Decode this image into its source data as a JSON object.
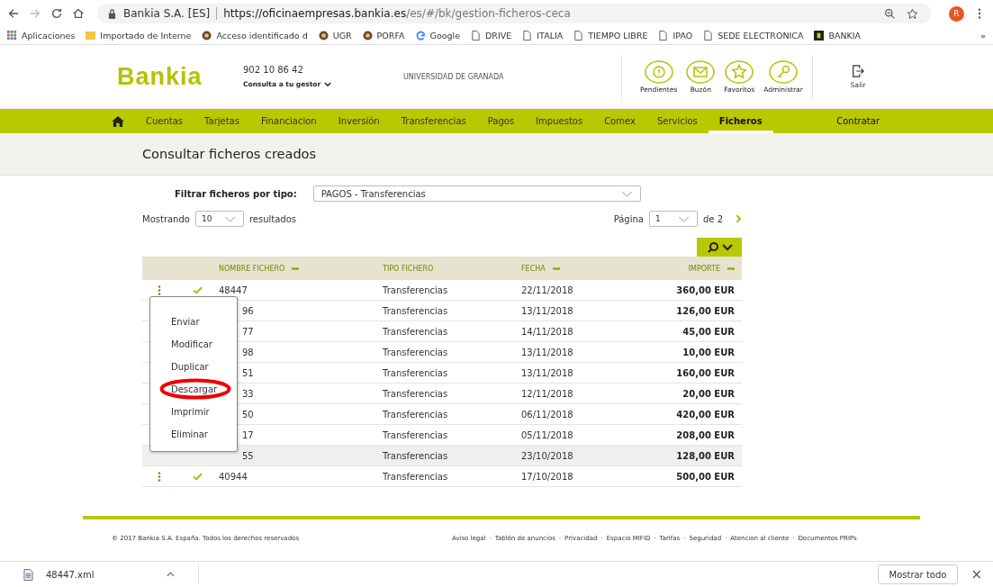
{
  "browser": {
    "site_name": "Bankia S.A. [ES]",
    "url_host": "https://oficinaempresas.bankia.es",
    "url_path": "/es/#/bk/gestion-ficheros-ceca",
    "profile_initial": "R",
    "bookmarks": [
      {
        "label": "Aplicaciones",
        "kind": "apps"
      },
      {
        "label": "Importado de Interne",
        "kind": "folder"
      },
      {
        "label": "Acceso identificado d",
        "kind": "crest"
      },
      {
        "label": "UGR",
        "kind": "crest"
      },
      {
        "label": "PORFA",
        "kind": "crest"
      },
      {
        "label": "Google",
        "kind": "google"
      },
      {
        "label": "DRIVE",
        "kind": "page"
      },
      {
        "label": "ITALIA",
        "kind": "page"
      },
      {
        "label": "TIEMPO LIBRE",
        "kind": "page"
      },
      {
        "label": "IPAO",
        "kind": "page"
      },
      {
        "label": "SEDE ELECTRONICA",
        "kind": "page"
      },
      {
        "label": "BANKIA",
        "kind": "brand"
      }
    ],
    "more": "»"
  },
  "header": {
    "logo": "Bankia",
    "phone": "902 10 86 42",
    "contact": "Consulta a tu gestor",
    "company": "UNIVERSIDAD DE GRANADA",
    "actions": [
      {
        "label": "Pendientes",
        "kind": "alert"
      },
      {
        "label": "Buzón",
        "kind": "mail"
      },
      {
        "label": "Favoritos",
        "kind": "star"
      },
      {
        "label": "Administrar",
        "kind": "key"
      }
    ],
    "logout": "Salir"
  },
  "nav": {
    "items": [
      {
        "label": "Cuentas",
        "selected": false
      },
      {
        "label": "Tarjetas",
        "selected": false
      },
      {
        "label": "Financiacion",
        "selected": false
      },
      {
        "label": "Inversión",
        "selected": false
      },
      {
        "label": "Transferencias",
        "selected": false
      },
      {
        "label": "Pagos",
        "selected": false
      },
      {
        "label": "Impuestos",
        "selected": false
      },
      {
        "label": "Comex",
        "selected": false
      },
      {
        "label": "Servicios",
        "selected": false
      },
      {
        "label": "Ficheros",
        "selected": true
      }
    ],
    "contract": "Contratar"
  },
  "page_title": "Consultar ficheros creados",
  "filter": {
    "label": "Filtrar ficheros por tipo:",
    "value": "PAGOS - Transferencias"
  },
  "paging": {
    "showing": "Mostrando",
    "per_page": "10",
    "results": "resultados",
    "page_label": "Página",
    "page": "1",
    "of": "de 2"
  },
  "table": {
    "columns": [
      "NOMBRE FICHERO",
      "TIPO FICHERO",
      "FECHA",
      "IMPORTE"
    ],
    "rows": [
      {
        "name": "48447",
        "type": "Transferencias",
        "date": "22/11/2018",
        "amount": "360,00 EUR",
        "covered": false,
        "highlighted": false
      },
      {
        "name": "96",
        "type": "Transferencias",
        "date": "13/11/2018",
        "amount": "126,00 EUR",
        "covered": true,
        "highlighted": false
      },
      {
        "name": "77",
        "type": "Transferencias",
        "date": "14/11/2018",
        "amount": "45,00 EUR",
        "covered": true,
        "highlighted": false
      },
      {
        "name": "98",
        "type": "Transferencias",
        "date": "13/11/2018",
        "amount": "10,00 EUR",
        "covered": true,
        "highlighted": false
      },
      {
        "name": "51",
        "type": "Transferencias",
        "date": "13/11/2018",
        "amount": "160,00 EUR",
        "covered": true,
        "highlighted": false
      },
      {
        "name": "33",
        "type": "Transferencias",
        "date": "12/11/2018",
        "amount": "20,00 EUR",
        "covered": true,
        "highlighted": false
      },
      {
        "name": "50",
        "type": "Transferencias",
        "date": "06/11/2018",
        "amount": "420,00 EUR",
        "covered": true,
        "highlighted": false
      },
      {
        "name": "17",
        "type": "Transferencias",
        "date": "05/11/2018",
        "amount": "208,00 EUR",
        "covered": true,
        "highlighted": false
      },
      {
        "name": "55",
        "type": "Transferencias",
        "date": "23/10/2018",
        "amount": "128,00 EUR",
        "covered": true,
        "highlighted": true
      },
      {
        "name": "40944",
        "type": "Transferencias",
        "date": "17/10/2018",
        "amount": "500,00 EUR",
        "covered": false,
        "highlighted": false
      }
    ]
  },
  "row_menu": {
    "items": [
      {
        "label": "Enviar",
        "circled": false
      },
      {
        "label": "Modificar",
        "circled": false
      },
      {
        "label": "Duplicar",
        "circled": false
      },
      {
        "label": "Descargar",
        "circled": true
      },
      {
        "label": "Imprimir",
        "circled": false
      },
      {
        "label": "Eliminar",
        "circled": false
      }
    ]
  },
  "footer": {
    "copyright": "© 2017 Bankia S.A. España. Todos los derechos reservados",
    "links": [
      "Aviso legal",
      "Tablón de anuncios",
      "Privacidad",
      "Espacio MIFID",
      "Tarifas",
      "Seguridad",
      "Atencion al cliente",
      "Documentos PRIPs"
    ],
    "separator": "·"
  },
  "download_bar": {
    "file": "48447.xml",
    "show_all": "Mostrar todo",
    "close": "×"
  }
}
